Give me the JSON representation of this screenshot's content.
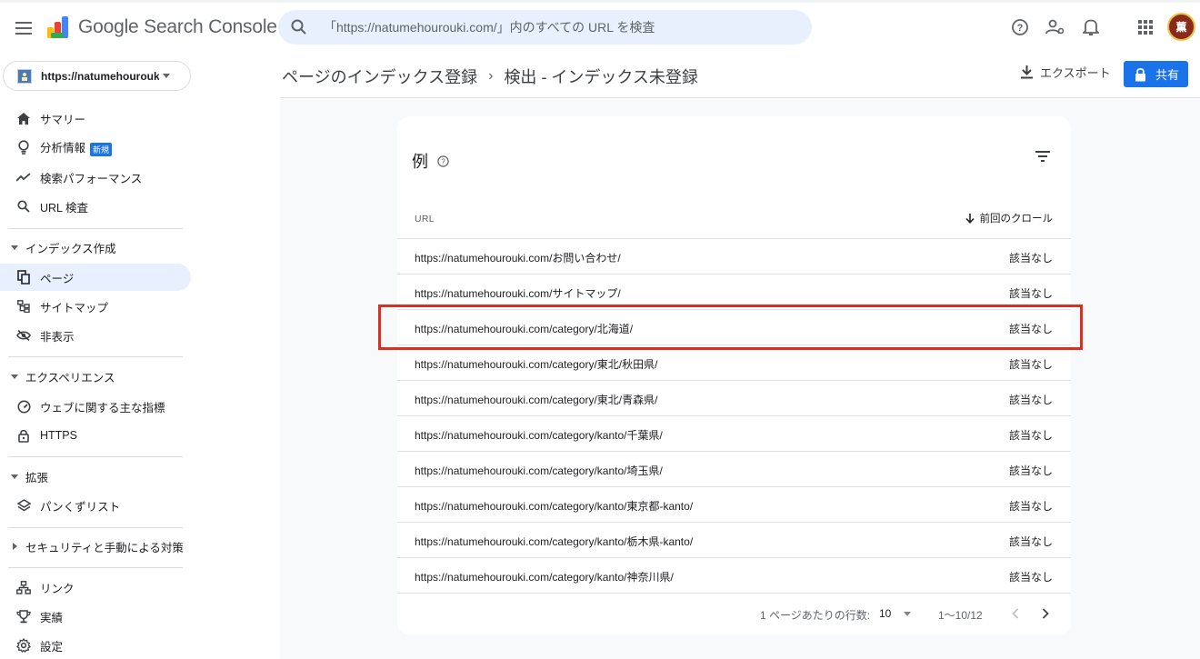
{
  "app": {
    "title": "Google Search Console"
  },
  "search": {
    "placeholder": "「https://natumehourouki.com/」内のすべての URL を検査"
  },
  "property": {
    "label": "https://natumehourouki..."
  },
  "user": {
    "avatar_char": "薫"
  },
  "sidebar": {
    "items_top": [
      {
        "label": "サマリー",
        "icon": "home-icon"
      },
      {
        "label": "分析情報",
        "icon": "lightbulb-icon",
        "badge": "新規"
      },
      {
        "label": "検索パフォーマンス",
        "icon": "trending-icon"
      },
      {
        "label": "URL 検査",
        "icon": "search-icon"
      }
    ],
    "section_index": {
      "label": "インデックス作成",
      "items": [
        {
          "label": "ページ",
          "icon": "pages-icon",
          "active": true
        },
        {
          "label": "サイトマップ",
          "icon": "sitemap-icon"
        },
        {
          "label": "非表示",
          "icon": "hidden-icon"
        }
      ]
    },
    "section_experience": {
      "label": "エクスペリエンス",
      "items": [
        {
          "label": "ウェブに関する主な指標",
          "icon": "speed-icon"
        },
        {
          "label": "HTTPS",
          "icon": "lock-icon"
        }
      ]
    },
    "section_enhancements": {
      "label": "拡張",
      "items": [
        {
          "label": "パンくずリスト",
          "icon": "layers-icon"
        }
      ]
    },
    "section_security": {
      "label": "セキュリティと手動による対策"
    },
    "items_bottom": [
      {
        "label": "リンク",
        "icon": "links-icon"
      },
      {
        "label": "実績",
        "icon": "trophy-icon"
      },
      {
        "label": "設定",
        "icon": "settings-icon"
      }
    ]
  },
  "header": {
    "breadcrumb_1": "ページのインデックス登録",
    "breadcrumb_sep": "›",
    "breadcrumb_2": "検出 - インデックス未登録",
    "export_label": "エクスポート",
    "share_label": "共有"
  },
  "table": {
    "title": "例",
    "col_url": "URL",
    "col_crawl": "前回のクロール",
    "rows": [
      {
        "url": "https://natumehourouki.com/お問い合わせ/",
        "crawl": "該当なし"
      },
      {
        "url": "https://natumehourouki.com/サイトマップ/",
        "crawl": "該当なし"
      },
      {
        "url": "https://natumehourouki.com/category/北海道/",
        "crawl": "該当なし"
      },
      {
        "url": "https://natumehourouki.com/category/東北/秋田県/",
        "crawl": "該当なし"
      },
      {
        "url": "https://natumehourouki.com/category/東北/青森県/",
        "crawl": "該当なし"
      },
      {
        "url": "https://natumehourouki.com/category/kanto/千葉県/",
        "crawl": "該当なし"
      },
      {
        "url": "https://natumehourouki.com/category/kanto/埼玉県/",
        "crawl": "該当なし"
      },
      {
        "url": "https://natumehourouki.com/category/kanto/東京都-kanto/",
        "crawl": "該当なし"
      },
      {
        "url": "https://natumehourouki.com/category/kanto/栃木県-kanto/",
        "crawl": "該当なし"
      },
      {
        "url": "https://natumehourouki.com/category/kanto/神奈川県/",
        "crawl": "該当なし"
      }
    ],
    "highlighted_row": 3
  },
  "pager": {
    "rows_per_page_label": "1 ページあたりの行数:",
    "rows_per_page": "10",
    "range": "1〜10/12"
  },
  "colors": {
    "accent": "#1a73e8",
    "highlight": "#d93025",
    "active_bg": "#e8f0fe"
  }
}
